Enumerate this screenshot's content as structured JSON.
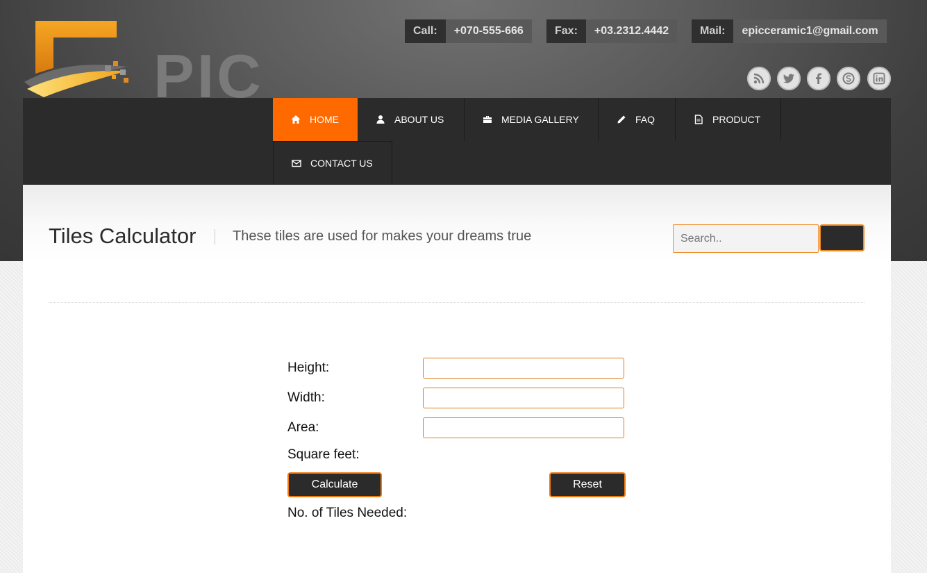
{
  "brand": {
    "logo_text": "PIC"
  },
  "contact": {
    "call_label": "Call:",
    "call_value": "+070-555-666",
    "fax_label": "Fax:",
    "fax_value": "+03.2312.4442",
    "mail_label": "Mail:",
    "mail_value": "epicceramic1@gmail.com"
  },
  "social": [
    "rss-icon",
    "twitter-icon",
    "facebook-icon",
    "skype-icon",
    "linkedin-icon"
  ],
  "nav": {
    "home": "HOME",
    "about": "ABOUT US",
    "media": "MEDIA GALLERY",
    "faq": "FAQ",
    "product": "PRODUCT",
    "contact": "CONTACT US"
  },
  "page": {
    "title": "Tiles Calculator",
    "subtitle": "These tiles are used for makes your dreams true"
  },
  "search": {
    "placeholder": "Search..",
    "value": ""
  },
  "calculator": {
    "height_label": "Height:",
    "width_label": "Width:",
    "area_label": "Area:",
    "square_feet_label": "Square feet:",
    "calculate_label": "Calculate",
    "reset_label": "Reset",
    "tiles_needed_label": "No. of Tiles Needed:"
  },
  "colors": {
    "accent": "#ff6a00",
    "dark": "#2b2b2b",
    "field_border": "#e07a18"
  }
}
